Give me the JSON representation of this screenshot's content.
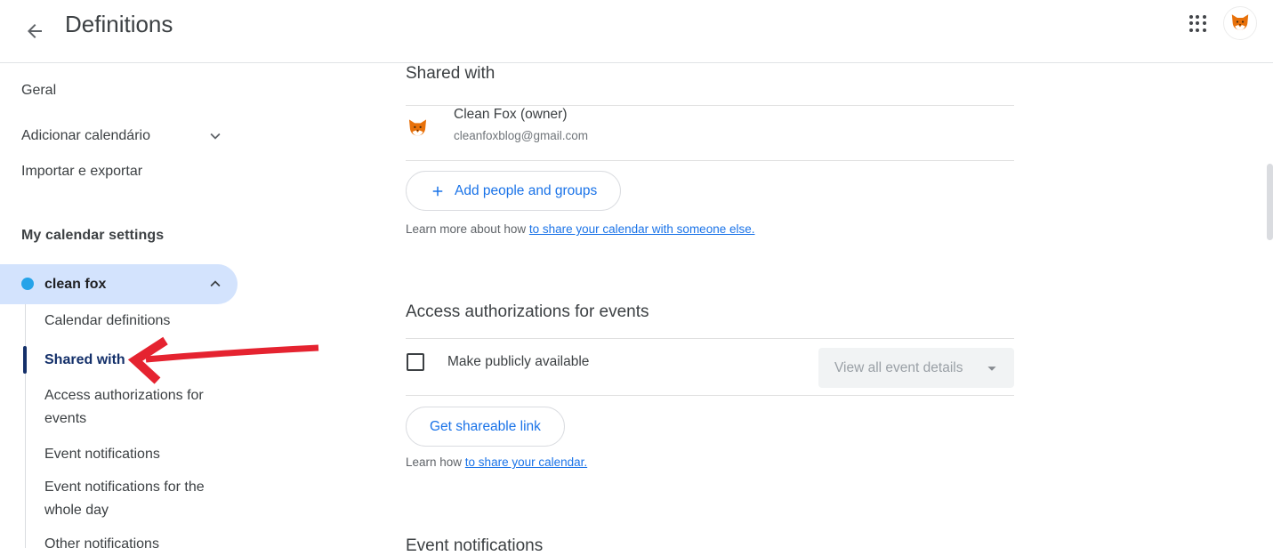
{
  "topbar": {
    "title": "Definitions"
  },
  "sidebar": {
    "items": [
      {
        "label": "Geral"
      },
      {
        "label": "Adicionar calendário"
      },
      {
        "label": "Importar e exportar"
      }
    ],
    "section_header": "My calendar settings",
    "calendar_name": "clean fox",
    "subitems": [
      {
        "label": "Calendar definitions"
      },
      {
        "label": "Shared with"
      },
      {
        "label": "Access authorizations for events"
      },
      {
        "label": "Event notifications"
      },
      {
        "label": "Event notifications for the whole day"
      },
      {
        "label": "Other notifications"
      }
    ]
  },
  "main": {
    "shared_with": {
      "heading": "Shared with",
      "owner_name": "Clean Fox (owner)",
      "owner_email": "cleanfoxblog@gmail.com",
      "add_button_label": "Add people and groups",
      "learn_text": "Learn more about how ",
      "learn_link": "to share your calendar with someone else."
    },
    "access_auth": {
      "heading": "Access authorizations for events",
      "checkbox_label": "Make publicly available",
      "checkbox_checked": false,
      "dropdown_value": "View all event details",
      "share_button_label": "Get shareable link",
      "learn_text": "Learn how ",
      "learn_link": "to share your calendar."
    },
    "next_section_heading": "Event notifications"
  },
  "colors": {
    "accent_blue": "#1a73e8",
    "active_navy": "#14306a",
    "selected_pill_bg": "#d3e3fd",
    "calendar_dot": "#25a3e9",
    "annotation_red": "#e52330",
    "divider": "#e0e0e0"
  }
}
